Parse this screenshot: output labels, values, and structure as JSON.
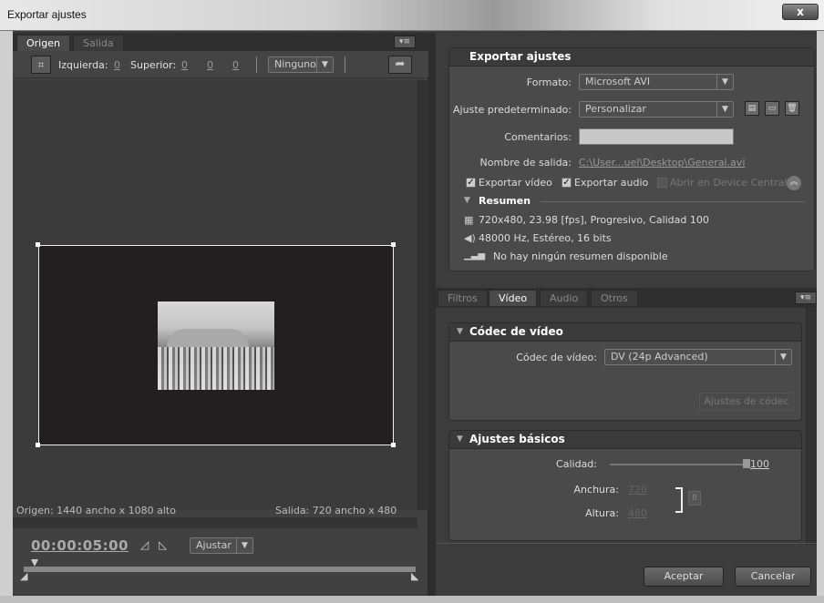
{
  "window": {
    "title": "Exportar ajustes",
    "close_glyph": "x"
  },
  "source": {
    "tabs": [
      {
        "label": "Origen"
      },
      {
        "label": "Salida"
      }
    ],
    "toolbar": {
      "left_label": "Izquierda:",
      "left_value": "0",
      "top_label": "Superior:",
      "values": [
        "0",
        "0",
        "0"
      ],
      "ratio_dropdown": "Ninguno"
    },
    "origin_info": "Origen: 1440 ancho x 1080 alto",
    "output_info": "Salida: 720 ancho x 480 alto",
    "timecode": "00:00:05:00",
    "fit_dropdown": "Ajustar"
  },
  "export_settings": {
    "header": "Exportar ajustes",
    "format_label": "Formato:",
    "format_value": "Microsoft AVI",
    "preset_label": "Ajuste predeterminado:",
    "preset_value": "Personalizar",
    "comments_label": "Comentarios:",
    "comments_value": "",
    "output_name_label": "Nombre de salida:",
    "output_name_value": "C:\\User...uel\\Desktop\\General.avi",
    "export_video_label": "Exportar vídeo",
    "export_audio_label": "Exportar audio",
    "open_device_central_label": "Abrir en Device Central",
    "summary_header": "Resumen",
    "summary_video": "720x480, 23.98 [fps], Progresivo, Calidad 100",
    "summary_audio": "48000 Hz, Estéreo, 16 bits",
    "summary_none": "No hay ningún resumen disponible"
  },
  "settings_tabs": [
    {
      "label": "Filtros"
    },
    {
      "label": "Vídeo"
    },
    {
      "label": "Audio"
    },
    {
      "label": "Otros"
    }
  ],
  "codec_group": {
    "header": "Códec de vídeo",
    "codec_label": "Códec de vídeo:",
    "codec_value": "DV (24p Advanced)",
    "codec_settings_button": "Ajustes de códec"
  },
  "basic_group": {
    "header": "Ajustes básicos",
    "quality_label": "Calidad:",
    "quality_value": "100",
    "width_label": "Anchura:",
    "width_value": "720",
    "height_label": "Altura:",
    "height_value": "480"
  },
  "buttons": {
    "accept": "Aceptar",
    "cancel": "Cancelar"
  }
}
